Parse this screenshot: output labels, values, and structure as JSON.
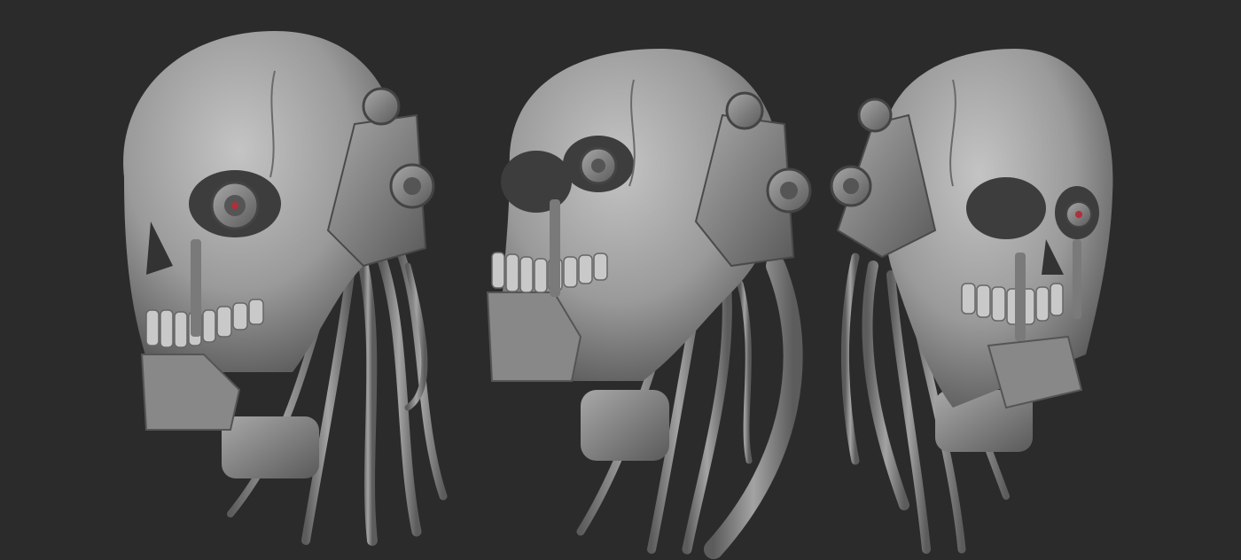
{
  "scene": {
    "background_color": "#2b2b2b",
    "material_color": "#9a9a9a",
    "eye_accent_color": "#b0303a",
    "subject": "cyborg-skull",
    "views": [
      {
        "id": "three-quarter-left",
        "eye": "cyborg-eye"
      },
      {
        "id": "front-three-quarter",
        "eye": "cyborg-eye"
      },
      {
        "id": "three-quarter-right",
        "eye": "cyborg-eye"
      }
    ]
  }
}
